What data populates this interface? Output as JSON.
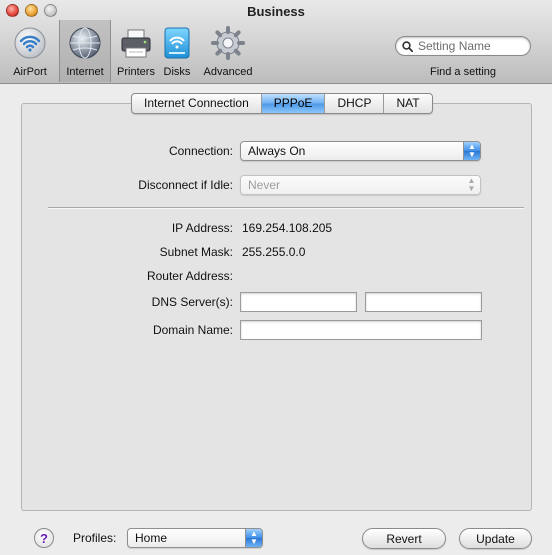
{
  "window": {
    "title": "Business"
  },
  "toolbar": {
    "items": [
      {
        "label": "AirPort",
        "icon": "airport-icon"
      },
      {
        "label": "Internet",
        "icon": "internet-icon",
        "selected": true
      },
      {
        "label": "Printers",
        "icon": "printer-icon"
      },
      {
        "label": "Disks",
        "icon": "disk-icon"
      },
      {
        "label": "Advanced",
        "icon": "gear-icon"
      }
    ],
    "search": {
      "placeholder": "Setting Name",
      "value": ""
    },
    "find_label": "Find a setting"
  },
  "tabs": [
    {
      "label": "Internet Connection",
      "active": false
    },
    {
      "label": "PPPoE",
      "active": true
    },
    {
      "label": "DHCP",
      "active": false
    },
    {
      "label": "NAT",
      "active": false
    }
  ],
  "form": {
    "connection": {
      "label": "Connection:",
      "value": "Always On"
    },
    "disconnect_idle": {
      "label": "Disconnect if Idle:",
      "value": "Never"
    },
    "ip_address": {
      "label": "IP Address:",
      "value": "169.254.108.205"
    },
    "subnet_mask": {
      "label": "Subnet Mask:",
      "value": "255.255.0.0"
    },
    "router_address": {
      "label": "Router Address:",
      "value": ""
    },
    "dns_servers": {
      "label": "DNS Server(s):",
      "value1": "",
      "value2": ""
    },
    "domain_name": {
      "label": "Domain Name:",
      "value": ""
    }
  },
  "footer": {
    "help": "?",
    "profiles_label": "Profiles:",
    "profiles_value": "Home",
    "revert_label": "Revert",
    "update_label": "Update"
  },
  "colors": {
    "tab_active": "#5aa2ec",
    "help_glyph": "#6a1fb0"
  }
}
